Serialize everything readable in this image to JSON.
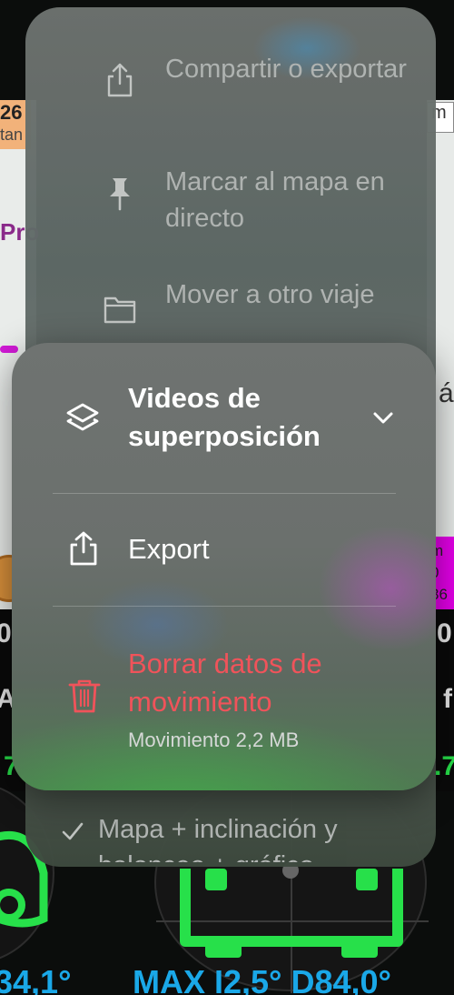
{
  "background": {
    "badge_number": "26",
    "badge_sub": "tan",
    "right_tag": "m",
    "left_map_text": "Pro",
    "magenta_lines": [
      "m",
      "0",
      "36",
      "86"
    ],
    "edge_left_chars": [
      "0:",
      "A"
    ],
    "edge_right_chars": [
      "0",
      "f",
      "á"
    ],
    "green_left": "7",
    "green_right": ".7",
    "bottom_left": "34,1°",
    "bottom_right": "MAX I2,5° D84,0°"
  },
  "back_menu": {
    "items": [
      {
        "icon": "share-icon",
        "label": "Compartir o exportar"
      },
      {
        "icon": "pin-icon",
        "label": "Marcar al mapa en directo"
      },
      {
        "icon": "folder-icon",
        "label": "Mover a otro viaje"
      }
    ],
    "checked_option": {
      "icon": "checkmark-icon",
      "label": "Mapa + inclinación y balanceo + gráfico"
    }
  },
  "front_menu": {
    "overlay": {
      "icon": "layers-icon",
      "label": "Videos de superposición",
      "chevron": "chevron-down-icon"
    },
    "export": {
      "icon": "share-icon",
      "label": "Export"
    },
    "delete": {
      "icon": "trash-icon",
      "label": "Borrar datos de movimiento",
      "subtitle": "Movimiento 2,2 MB",
      "color": "#f0535a"
    }
  },
  "colors": {
    "accent_green": "#27e04a",
    "accent_blue": "#1aa8e8",
    "danger_red": "#f0535a"
  }
}
